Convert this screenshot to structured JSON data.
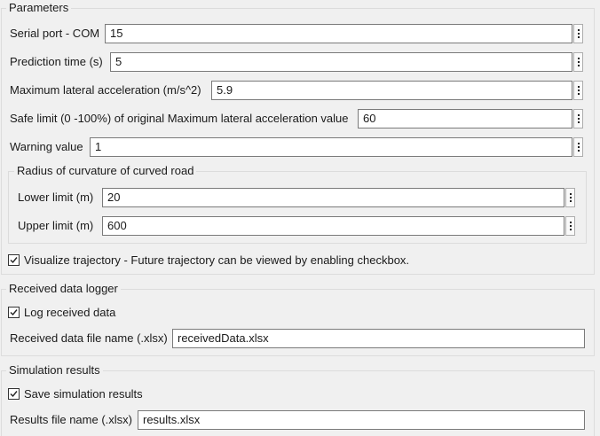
{
  "parameters": {
    "title": "Parameters",
    "serial_port": {
      "label": "Serial port - COM",
      "value": "15"
    },
    "prediction_time": {
      "label": "Prediction time (s)",
      "value": "5"
    },
    "max_lateral_accel": {
      "label": "Maximum lateral acceleration (m/s^2)",
      "value": "5.9"
    },
    "safe_limit": {
      "label": "Safe limit (0 -100%) of original Maximum lateral acceleration value",
      "value": "60"
    },
    "warning_value": {
      "label": "Warning value",
      "value": "1"
    },
    "radius": {
      "title": "Radius of curvature of curved road",
      "lower_limit": {
        "label": "Lower limit (m)",
        "value": "20"
      },
      "upper_limit": {
        "label": "Upper limit (m)",
        "value": "600"
      }
    },
    "visualize": {
      "label": "Visualize trajectory - Future trajectory can be viewed by enabling checkbox.",
      "checked": true
    }
  },
  "logger": {
    "title": "Received data logger",
    "log": {
      "label": "Log received data",
      "checked": true
    },
    "file": {
      "label": "Received data file name (.xlsx)",
      "value": "receivedData.xlsx"
    }
  },
  "simulation": {
    "title": "Simulation results",
    "save": {
      "label": "Save simulation results",
      "checked": true
    },
    "file": {
      "label": "Results file name (.xlsx)",
      "value": "results.xlsx"
    }
  }
}
